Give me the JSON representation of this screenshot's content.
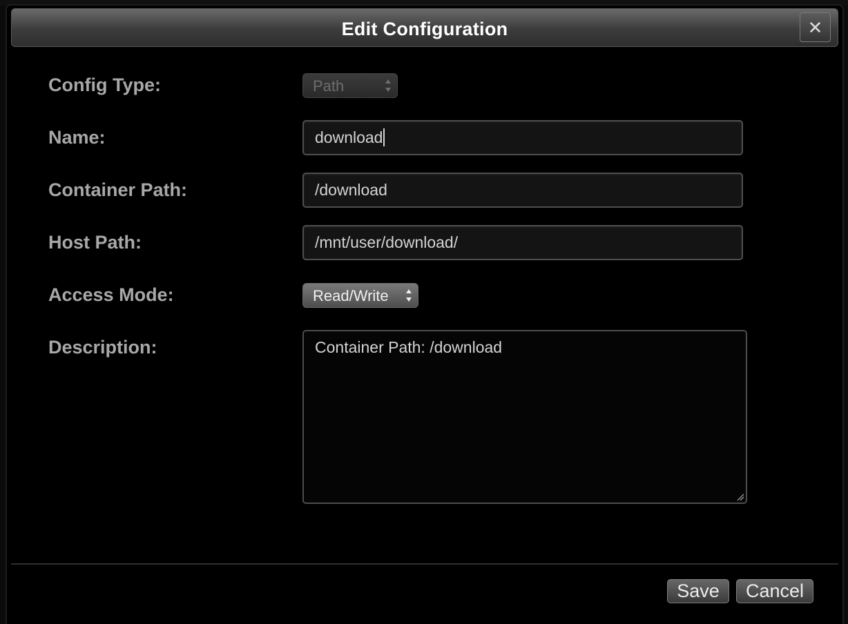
{
  "dialog": {
    "title": "Edit Configuration",
    "close_icon": "close-icon"
  },
  "form": {
    "config_type": {
      "label": "Config Type:",
      "value": "Path",
      "disabled": true
    },
    "name": {
      "label": "Name:",
      "value": "download"
    },
    "container_path": {
      "label": "Container Path:",
      "value": "/download"
    },
    "host_path": {
      "label": "Host Path:",
      "value": "/mnt/user/download/"
    },
    "access_mode": {
      "label": "Access Mode:",
      "value": "Read/Write"
    },
    "description": {
      "label": "Description:",
      "value": "Container Path: /download"
    }
  },
  "buttons": {
    "save": "Save",
    "cancel": "Cancel"
  },
  "colors": {
    "dialog_background": "#000000",
    "label_text": "#a8a8a8",
    "field_border": "#4e4e4e",
    "title_text": "#ffffff"
  }
}
